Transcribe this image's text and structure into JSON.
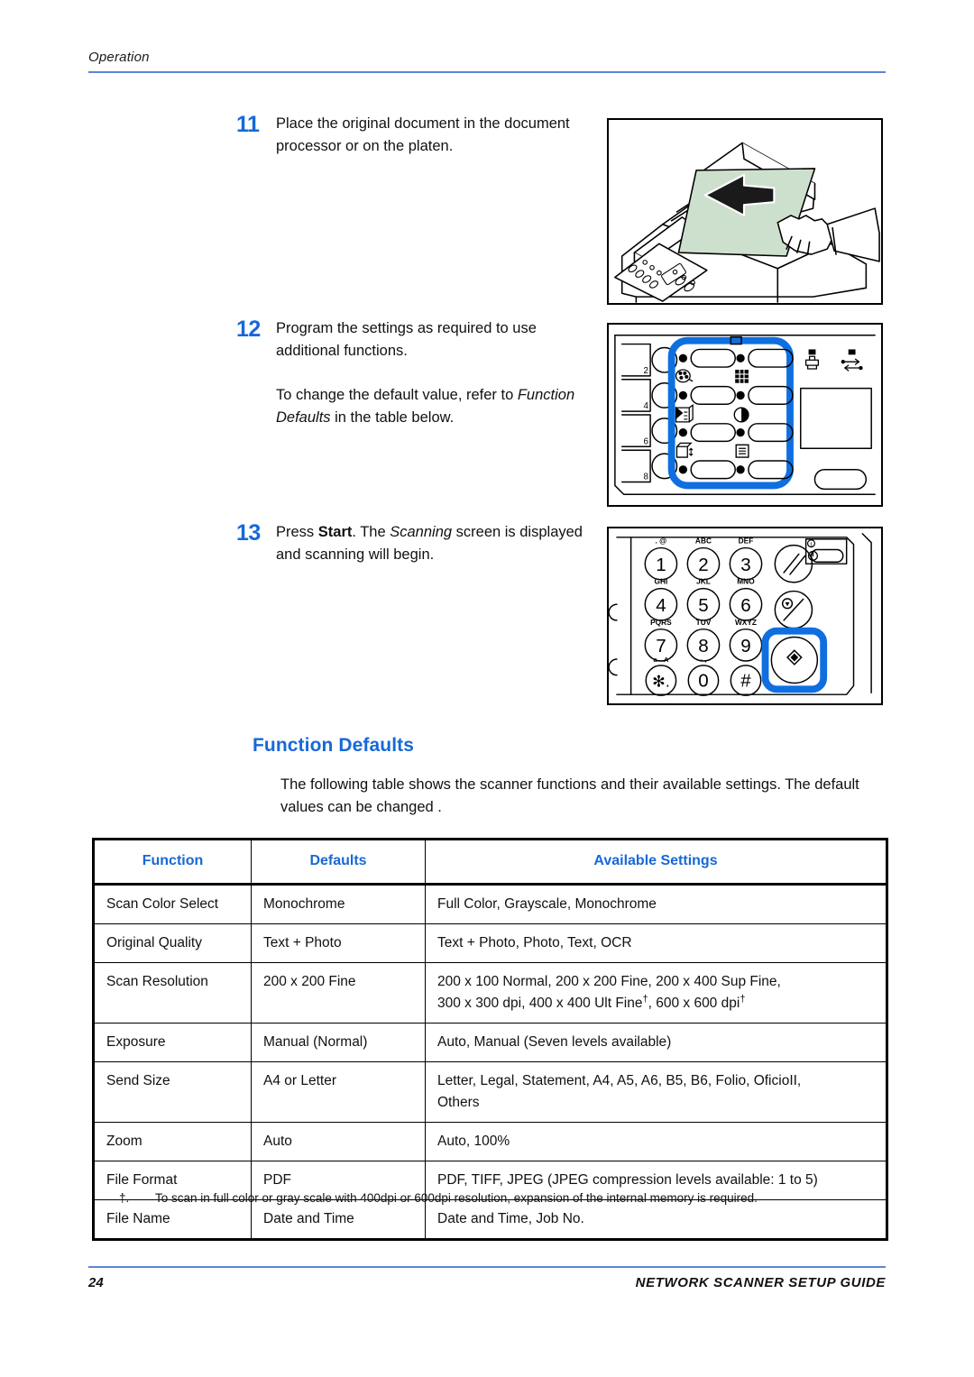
{
  "header": {
    "title": "Operation"
  },
  "steps": [
    {
      "number": "11",
      "line1": "Place the original document in the",
      "line2": "document processor or on the platen."
    },
    {
      "number": "12",
      "para1": "Program the settings as required to use additional functions.",
      "para2_pre": "To change the default value, refer to ",
      "para2_italic": "Function Defaults",
      "para2_post": " in the table below."
    },
    {
      "number": "13",
      "pre": "Press ",
      "bold": "Start",
      "mid": ". The ",
      "italic": "Scanning",
      "post": " screen is displayed and scanning will begin."
    }
  ],
  "figures": {
    "fig1": {
      "name": "document-processor-loading-illustration",
      "paper_color": "#cde0cd"
    },
    "fig2": {
      "name": "control-panel-function-keys-illustration",
      "highlight_color": "#0f6fe0",
      "side_key_labels": [
        "2",
        "4",
        "6",
        "8"
      ]
    },
    "fig3": {
      "name": "numeric-keypad-start-key-illustration",
      "highlight_color": "#0f6fe0",
      "keys": [
        {
          "digit": "1",
          "letters": ". @"
        },
        {
          "digit": "2",
          "letters": "ABC"
        },
        {
          "digit": "3",
          "letters": "DEF"
        },
        {
          "digit": "4",
          "letters": "GHI"
        },
        {
          "digit": "5",
          "letters": "JKL"
        },
        {
          "digit": "6",
          "letters": "MNO"
        },
        {
          "digit": "7",
          "letters": "PQRS"
        },
        {
          "digit": "8",
          "letters": "TUV"
        },
        {
          "digit": "9",
          "letters": "WXYZ"
        },
        {
          "digit": "✳.",
          "letters": "a↔A"
        },
        {
          "digit": "0",
          "letters": "- ,"
        },
        {
          "digit": "#",
          "letters": ""
        }
      ],
      "function_keys": [
        "reset-key",
        "stop-clear-key",
        "start-key"
      ]
    }
  },
  "section": {
    "heading": "Function Defaults",
    "intro": "The following table shows the scanner functions and their available settings.  The default values can be changed ."
  },
  "table": {
    "headers": [
      "Function",
      "Defaults",
      "Available Settings"
    ],
    "rows": [
      {
        "function": "Scan Color Select",
        "defaults": "Monochrome",
        "available_line1": "Full Color, Grayscale, Monochrome",
        "available_line2": ""
      },
      {
        "function": "Original Quality",
        "defaults": "Text + Photo",
        "available_line1": "Text + Photo, Photo, Text, OCR",
        "available_line2": ""
      },
      {
        "function": "Scan Resolution",
        "defaults": "200 x 200 Fine",
        "available_line1": "200 x 100 Normal, 200 x 200 Fine, 200 x 400 Sup Fine,",
        "available_line2_a": "300 x 300 dpi, 400 x 400 Ult Fine",
        "available_line2_b": ", 600 x 600 dpi",
        "dagger": "†"
      },
      {
        "function": "Exposure",
        "defaults": "Manual (Normal)",
        "available_line1": "Auto, Manual (Seven levels available)",
        "available_line2": ""
      },
      {
        "function": "Send Size",
        "defaults": "A4 or Letter",
        "available_line1": "Letter, Legal, Statement, A4, A5, A6, B5, B6, Folio, OficioII,",
        "available_line2": "Others"
      },
      {
        "function": "Zoom",
        "defaults": "Auto",
        "available_line1": "Auto, 100%",
        "available_line2": ""
      },
      {
        "function": "File Format",
        "defaults": "PDF",
        "available_line1": "PDF, TIFF, JPEG (JPEG compression levels available: 1 to 5)",
        "available_line2": ""
      },
      {
        "function": "File Name",
        "defaults": "Date and Time",
        "available_line1": "Date and Time, Job No.",
        "available_line2": ""
      }
    ]
  },
  "footnote": {
    "mark": "†.",
    "text": "To scan in full color or gray scale with 400dpi or 600dpi resolution, expansion of the internal memory is required."
  },
  "footer": {
    "page_number": "24",
    "guide_title": "NETWORK SCANNER SETUP GUIDE"
  },
  "colors": {
    "accent_blue": "#1768d8",
    "rule_blue": "#5a86d8",
    "highlight_blue": "#0f6fe0",
    "paper_green": "#cde0cd"
  }
}
